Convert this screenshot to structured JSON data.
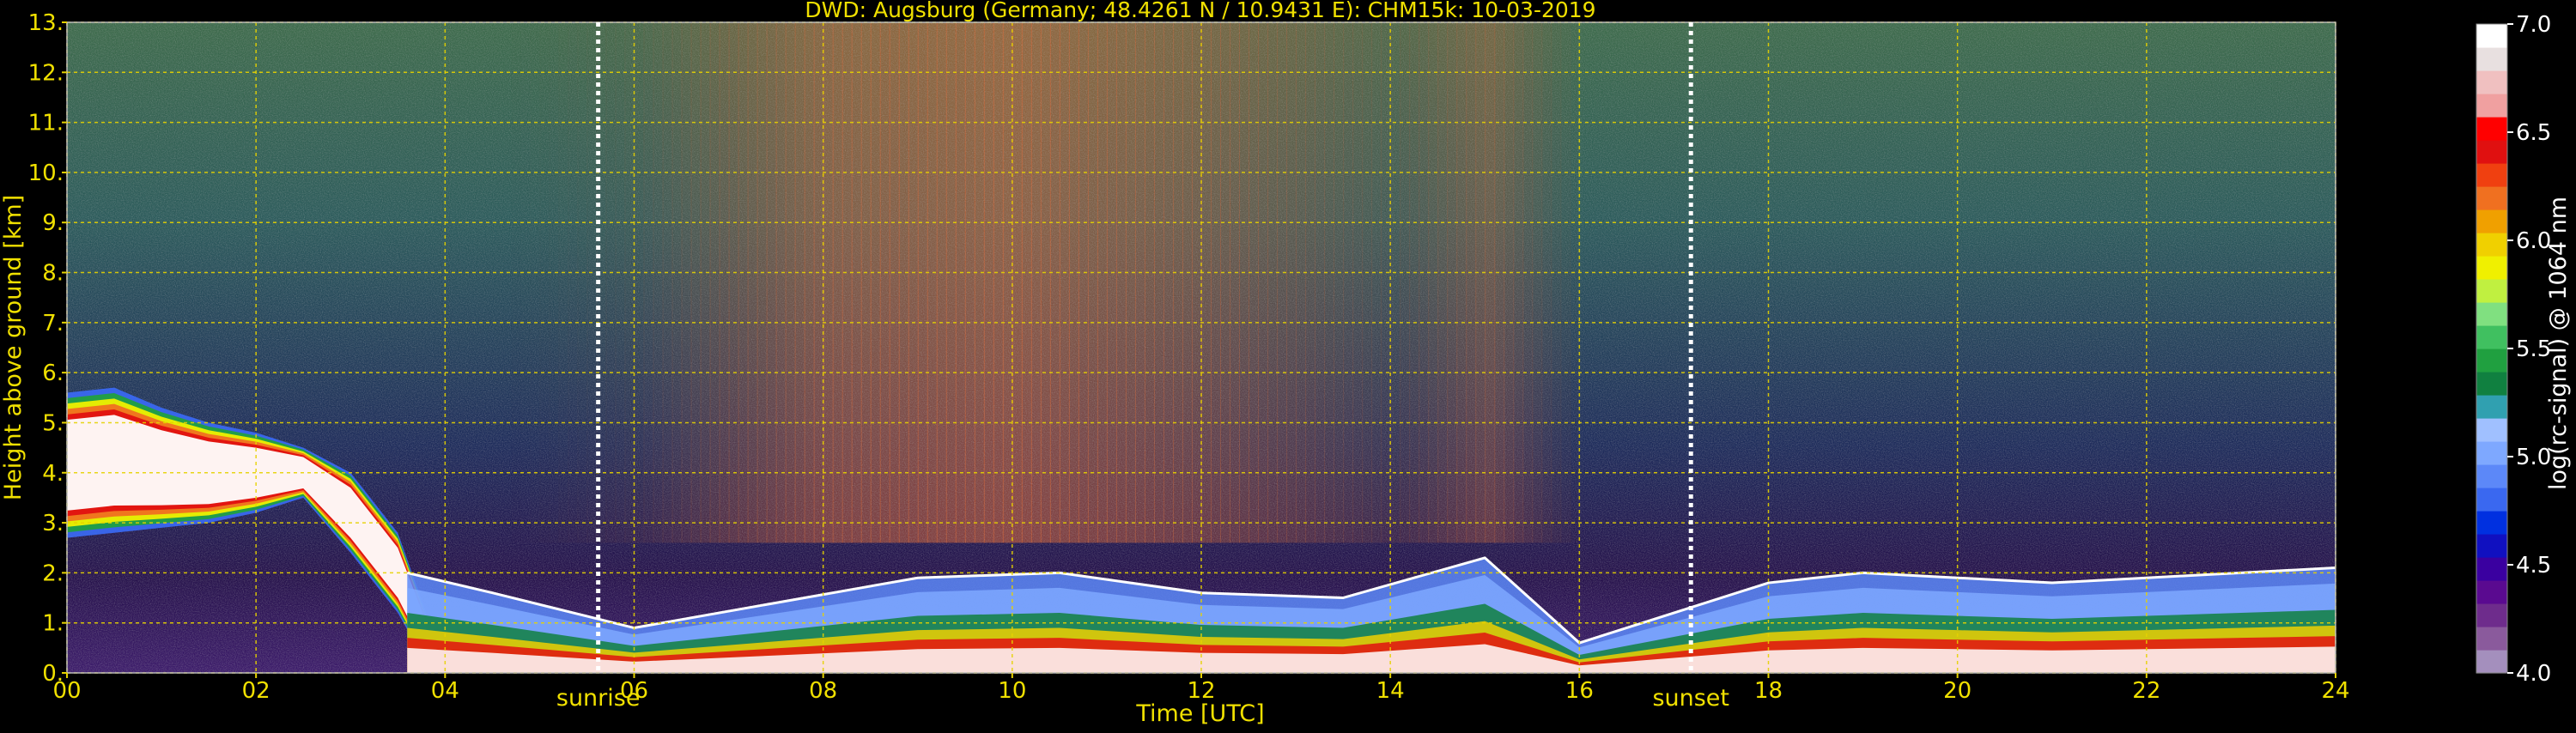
{
  "chart_data": {
    "type": "heatmap",
    "title": "DWD: Augsburg (Germany; 48.4261 N / 10.9431 E):    CHM15k: 10-03-2019",
    "xlabel": "Time [UTC]",
    "ylabel": "Height above ground [km]",
    "xlim": [
      0,
      24
    ],
    "ylim": [
      0,
      13
    ],
    "x_ticks": [
      "00",
      "02",
      "04",
      "06",
      "08",
      "10",
      "12",
      "14",
      "16",
      "18",
      "20",
      "22",
      "24"
    ],
    "y_ticks": [
      "0.",
      "1.",
      "2.",
      "3.",
      "4.",
      "5.",
      "6.",
      "7.",
      "8.",
      "9.",
      "10.",
      "11.",
      "12.",
      "13."
    ],
    "grid": true,
    "colorbar": {
      "label": "log(rc-signal) @ 1064 nm",
      "range": [
        4.0,
        7.0
      ],
      "ticks": [
        "4.0",
        "4.5",
        "5.0",
        "5.5",
        "6.0",
        "6.5",
        "7.0"
      ],
      "colors": [
        "#a48fbd",
        "#8a5a9c",
        "#6e2c8c",
        "#5a0a90",
        "#3a00a0",
        "#1010c0",
        "#0030e0",
        "#3a68f0",
        "#5c88f8",
        "#7ea8ff",
        "#a0c0ff",
        "#30a0b0",
        "#108040",
        "#20a040",
        "#40c060",
        "#80e080",
        "#c0f040",
        "#f0f000",
        "#f0d000",
        "#f0a000",
        "#f07020",
        "#f04010",
        "#e01010",
        "#ff0000",
        "#f0a0a0",
        "#f0c0c0",
        "#e8e0e0",
        "#ffffff"
      ]
    },
    "annotations": [
      {
        "text": "sunrise",
        "x": 5.62
      },
      {
        "text": "sunset",
        "x": 17.18
      }
    ],
    "series": [
      {
        "name": "elevated aerosol / cloud layer (signal max)",
        "x": [
          0.0,
          0.5,
          1.0,
          1.5,
          2.0,
          2.5,
          3.0,
          3.5,
          3.8
        ],
        "base": [
          2.7,
          2.8,
          2.9,
          3.0,
          3.2,
          3.5,
          2.4,
          1.2,
          0.2
        ],
        "top": [
          5.6,
          5.7,
          5.3,
          5.0,
          4.8,
          4.5,
          4.0,
          2.8,
          1.2
        ]
      },
      {
        "name": "boundary layer top",
        "x": [
          3.6,
          4.5,
          6.0,
          7.5,
          9.0,
          10.5,
          12.0,
          13.5,
          15.0,
          16.0,
          17.0,
          18.0,
          19.0,
          20.0,
          21.0,
          22.0,
          23.0,
          24.0
        ],
        "top": [
          2.0,
          1.6,
          0.9,
          1.4,
          1.9,
          2.0,
          1.6,
          1.5,
          2.3,
          0.6,
          1.2,
          1.8,
          2.0,
          1.9,
          1.8,
          1.9,
          2.0,
          2.1
        ]
      }
    ],
    "background_profile": {
      "x": [
        0,
        2,
        4,
        6,
        7,
        8,
        9,
        10,
        11,
        12,
        13,
        14,
        15,
        16,
        18,
        20,
        22,
        24
      ],
      "intensity": [
        0.25,
        0.25,
        0.3,
        0.45,
        0.65,
        0.8,
        0.82,
        0.85,
        0.78,
        0.72,
        0.62,
        0.5,
        0.7,
        0.35,
        0.25,
        0.22,
        0.22,
        0.2
      ]
    }
  }
}
